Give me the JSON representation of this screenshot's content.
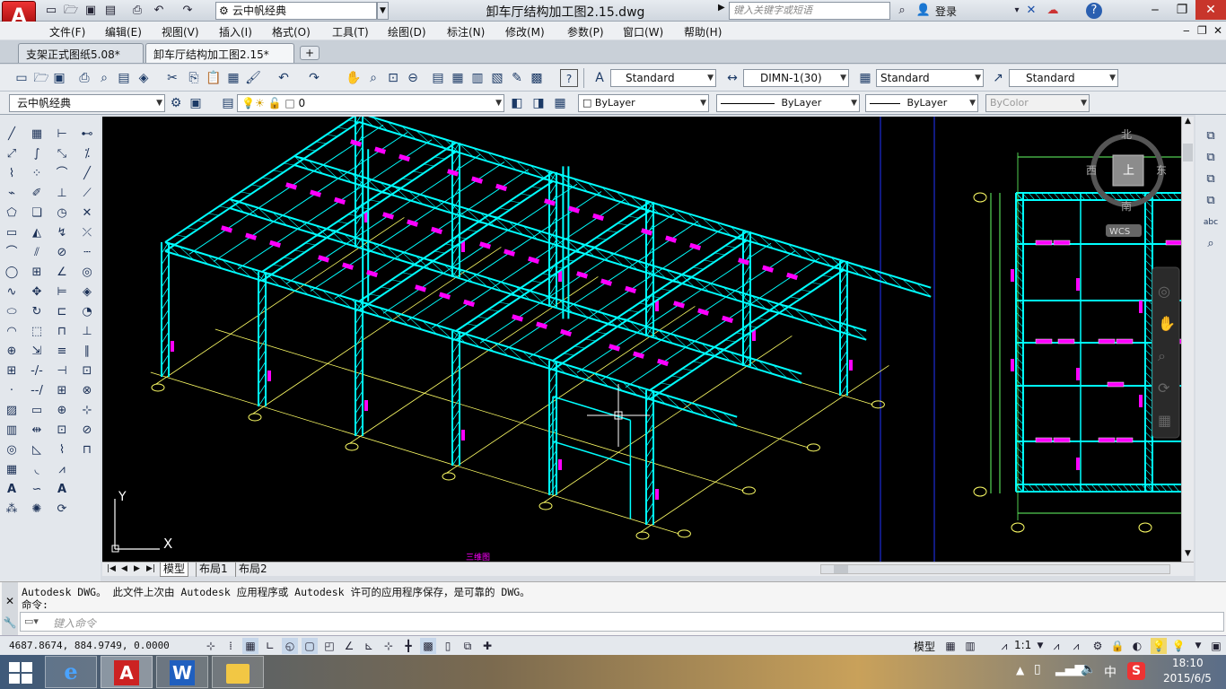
{
  "app": {
    "logo_letter": "A",
    "workspace": "云中帆经典",
    "document_title": "卸车厅结构加工图2.15.dwg",
    "search_placeholder": "键入关键字或短语",
    "login_label": "登录"
  },
  "menu": [
    "文件(F)",
    "编辑(E)",
    "视图(V)",
    "插入(I)",
    "格式(O)",
    "工具(T)",
    "绘图(D)",
    "标注(N)",
    "修改(M)",
    "参数(P)",
    "窗口(W)",
    "帮助(H)"
  ],
  "doc_tabs": [
    "支架正式图纸5.08*",
    "卸车厅结构加工图2.15*"
  ],
  "styles": {
    "text_style": "Standard",
    "dim_style": "DIMN-1(30)",
    "table_style": "Standard",
    "mleader_style": "Standard"
  },
  "layers_bar": {
    "workspace_combo": "云中帆经典",
    "layer": "0",
    "color": "ByLayer",
    "linetype": "ByLayer",
    "lineweight": "ByLayer",
    "plotstyle": "ByColor"
  },
  "viewcube": {
    "north": "北",
    "south": "南",
    "east": "东",
    "west": "西",
    "top": "上",
    "wcs": "WCS"
  },
  "drawing": {
    "axis_y": "Y",
    "axis_x": "X",
    "caption": "三维图"
  },
  "layout_tabs": [
    "模型",
    "布局1",
    "布局2"
  ],
  "command": {
    "history_line": "Autodesk DWG。  此文件上次由 Autodesk 应用程序或 Autodesk 许可的应用程序保存，是可靠的 DWG。",
    "prompt": "命令:",
    "input_placeholder": "键入命令"
  },
  "status": {
    "coords": "4687.8674, 884.9749, 0.0000",
    "model_label": "模型",
    "scale": "1:1"
  },
  "taskbar": {
    "time": "18:10",
    "date": "2015/6/5",
    "ime": "中"
  },
  "colors": {
    "structure": "#00ffff",
    "annotation": "#ff00ff",
    "gridline": "#ffff66",
    "canvas": "#000000"
  }
}
